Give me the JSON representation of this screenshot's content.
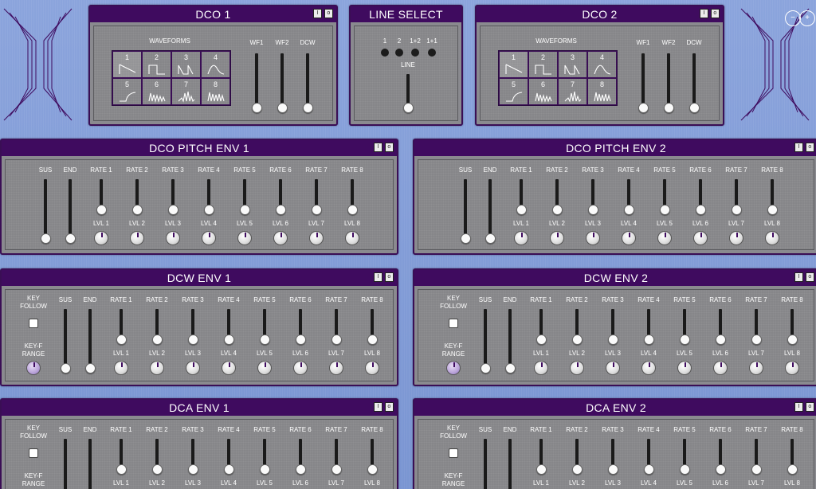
{
  "dco1": {
    "title": "DCO 1",
    "waveforms_label": "WAVEFORMS",
    "wf1": "WF1",
    "wf2": "WF2",
    "dcw": "DCW",
    "waves": [
      "1",
      "2",
      "3",
      "4",
      "5",
      "6",
      "7",
      "8"
    ]
  },
  "line_select": {
    "title": "LINE SELECT",
    "options": [
      "1",
      "2",
      "1+2",
      "1+1"
    ],
    "line_label": "LINE"
  },
  "dco2": {
    "title": "DCO 2",
    "waveforms_label": "WAVEFORMS",
    "wf1": "WF1",
    "wf2": "WF2",
    "dcw": "DCW",
    "waves": [
      "1",
      "2",
      "3",
      "4",
      "5",
      "6",
      "7",
      "8"
    ]
  },
  "pitch_env1": {
    "title": "DCO PITCH ENV 1"
  },
  "pitch_env2": {
    "title": "DCO PITCH ENV 2"
  },
  "dcw_env1": {
    "title": "DCW ENV 1"
  },
  "dcw_env2": {
    "title": "DCW ENV 2"
  },
  "dca_env1": {
    "title": "DCA ENV 1"
  },
  "dca_env2": {
    "title": "DCA ENV 2"
  },
  "common": {
    "sus": "SUS",
    "end": "END",
    "key_follow": [
      "KEY",
      "FOLLOW"
    ],
    "keyf_range": [
      "KEY-F",
      "RANGE"
    ],
    "rates": [
      "RATE 1",
      "RATE 2",
      "RATE 3",
      "RATE 4",
      "RATE 5",
      "RATE 6",
      "RATE 7",
      "RATE 8"
    ],
    "lvls": [
      "LVL 1",
      "LVL 2",
      "LVL 3",
      "LVL 4",
      "LVL 5",
      "LVL 6",
      "LVL 7",
      "LVL 8"
    ],
    "btn_i": "I",
    "btn_o": "o"
  },
  "colors": {
    "header": "#3f0b5f",
    "panel": "#8a8a8f",
    "background": "#7f9bd6"
  }
}
